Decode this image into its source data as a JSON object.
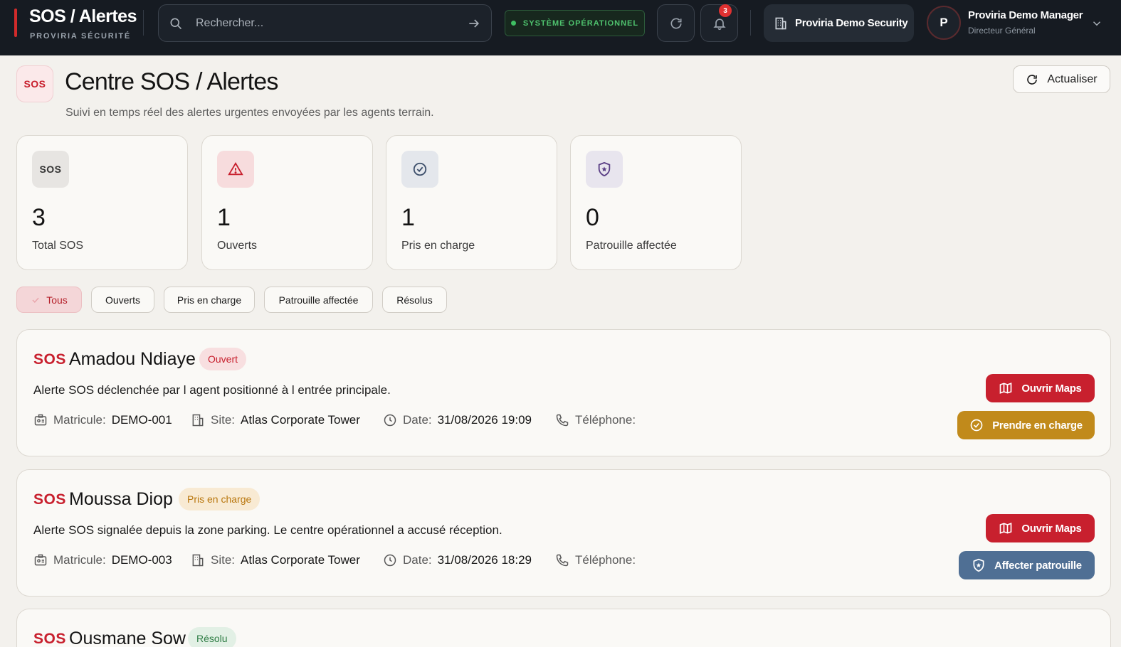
{
  "header": {
    "brand_title": "SOS / Alertes",
    "brand_subtitle": "PROVIRIA SÉCURITÉ",
    "search_placeholder": "Rechercher...",
    "system_status": "SYSTÈME OPÉRATIONNEL",
    "notification_count": "3",
    "organization": "Proviria Demo Security",
    "user_initial": "P",
    "user_name": "Proviria Demo Manager",
    "user_role": "Directeur Général"
  },
  "page": {
    "icon_text": "SOS",
    "title": "Centre SOS / Alertes",
    "subtitle": "Suivi en temps réel des alertes urgentes envoyées par les agents terrain.",
    "refresh_label": "Actualiser"
  },
  "stats": [
    {
      "icon_text": "SOS",
      "value": "3",
      "label": "Total SOS"
    },
    {
      "value": "1",
      "label": "Ouverts"
    },
    {
      "value": "1",
      "label": "Pris en charge"
    },
    {
      "value": "0",
      "label": "Patrouille affectée"
    }
  ],
  "filters": [
    {
      "label": "Tous",
      "active": true
    },
    {
      "label": "Ouverts"
    },
    {
      "label": "Pris en charge"
    },
    {
      "label": "Patrouille affectée"
    },
    {
      "label": "Résolus"
    }
  ],
  "labels": {
    "sos": "SOS",
    "matricule": "Matricule:",
    "site": "Site:",
    "date": "Date:",
    "phone": "Téléphone:",
    "open_maps": "Ouvrir Maps"
  },
  "alerts": [
    {
      "name": "Amadou Ndiaye",
      "status": "Ouvert",
      "description": "Alerte SOS déclenchée par l agent positionné à l entrée principale.",
      "matricule": "DEMO-001",
      "site": "Atlas Corporate Tower",
      "date": "31/08/2026 19:09",
      "action": "Prendre en charge"
    },
    {
      "name": "Moussa Diop",
      "status": "Pris en charge",
      "description": "Alerte SOS signalée depuis la zone parking. Le centre opérationnel a accusé réception.",
      "matricule": "DEMO-003",
      "site": "Atlas Corporate Tower",
      "date": "31/08/2026 18:29",
      "action": "Affecter patrouille"
    },
    {
      "name": "Ousmane Sow",
      "status": "Résolu"
    }
  ],
  "colors": {
    "accent_red": "#c8202e",
    "status_open": "#c8202e",
    "status_in_charge": "#b9770e",
    "status_resolved": "#2f7d45",
    "take_charge_button": "#c18a1b",
    "assign_patrol_button": "#4f6f94"
  }
}
